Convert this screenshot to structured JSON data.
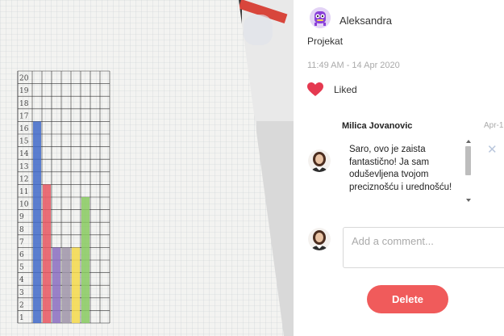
{
  "post": {
    "author": "Aleksandra",
    "caption": "Projekat",
    "timestamp": "11:49 AM - 14 Apr 2020",
    "liked_label": "Liked"
  },
  "photo": {
    "y_axis_labels": [
      "20",
      "19",
      "18",
      "17",
      "16",
      "15",
      "14",
      "13",
      "12",
      "11",
      "10",
      "9",
      "8",
      "7",
      "6",
      "5",
      "4",
      "3",
      "2",
      "1"
    ],
    "bars": [
      {
        "value": 16,
        "color": "#3f68c9"
      },
      {
        "value": 11,
        "color": "#e65560"
      },
      {
        "value": 6,
        "color": "#8a6cc0"
      },
      {
        "value": 6,
        "color": "#9d93a8"
      },
      {
        "value": 6,
        "color": "#f3d84a"
      },
      {
        "value": 10,
        "color": "#87c95f"
      }
    ]
  },
  "comment": {
    "user": "Milica Jovanovic",
    "date": "Apr-1",
    "text": "Saro, ovo je zaista fantastično! Ja sam oduševljena tvojom preciznošću i urednošću!"
  },
  "composer": {
    "placeholder": "Add a comment..."
  },
  "actions": {
    "delete_label": "Delete"
  },
  "colors": {
    "accent": "#f05b5b",
    "heart": "#e53950"
  }
}
